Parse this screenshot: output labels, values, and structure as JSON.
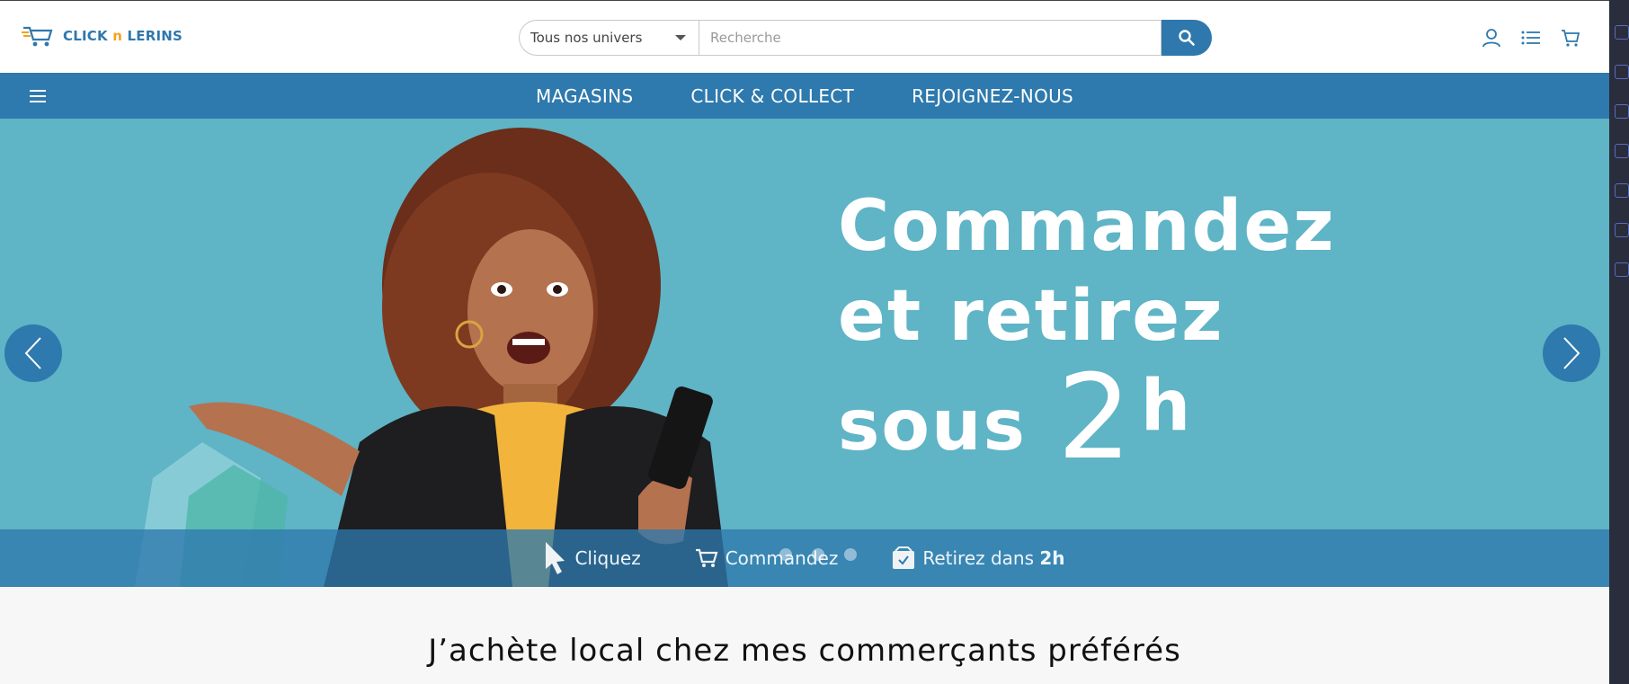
{
  "header": {
    "logo": {
      "part1": "CLICK ",
      "part2": "n",
      "part3": " LERINS"
    },
    "universe_select": {
      "value": "Tous nos univers"
    },
    "search": {
      "placeholder": "Recherche"
    },
    "icons": [
      "user-icon",
      "list-icon",
      "cart-icon"
    ]
  },
  "nav": {
    "links": [
      "MAGASINS",
      "CLICK & COLLECT",
      "REJOIGNEZ-NOUS"
    ]
  },
  "hero": {
    "line1": "Commandez",
    "line2": "et retirez",
    "line3": "sous",
    "big_number": "2",
    "unit": "h",
    "steps": {
      "click": "Cliquez",
      "order": "Commandez",
      "pickup_prefix": "Retirez dans ",
      "pickup_time": "2h"
    },
    "dots_count": 3
  },
  "section": {
    "title": "J’achète local chez mes commerçants préférés"
  },
  "colors": {
    "primary": "#2e79ad",
    "hero_bg": "#5fb4c6",
    "logo_accent": "#f2a31c"
  }
}
